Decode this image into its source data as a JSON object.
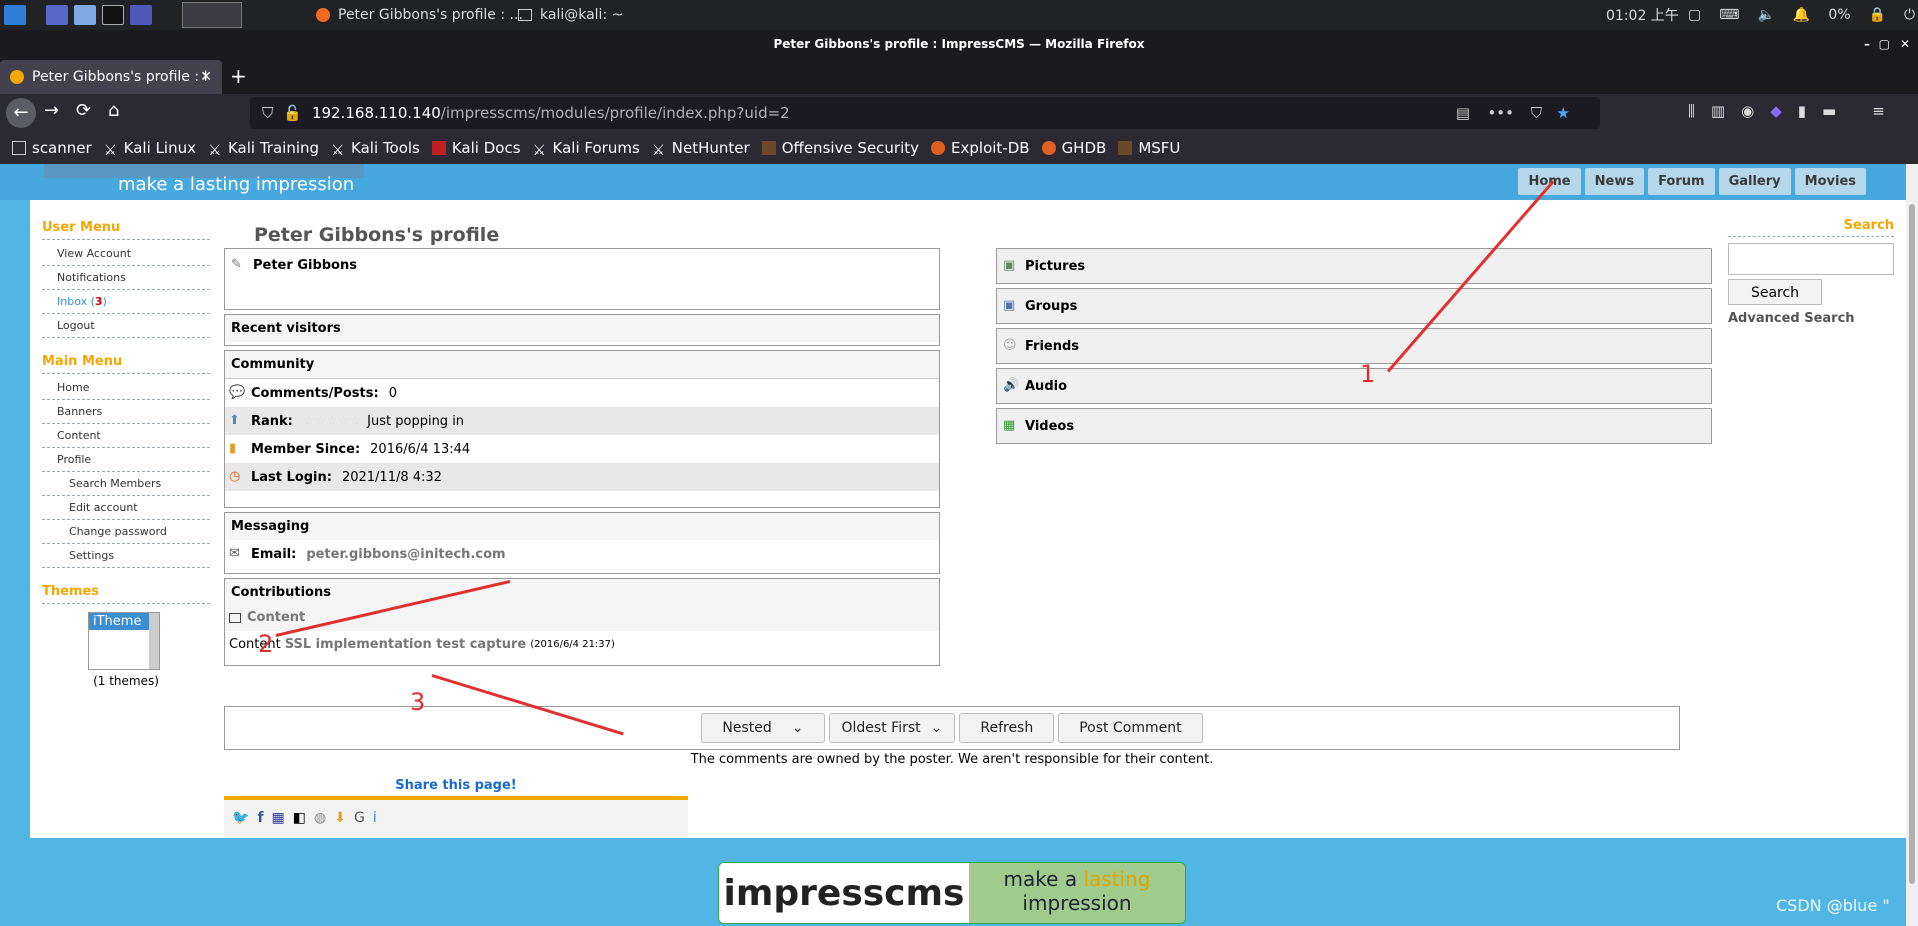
{
  "taskbar": {
    "task_firefox": "Peter Gibbons's profile : ...",
    "task_terminal": "kali@kali: ~",
    "time": "01:02 上午",
    "battery": "0%"
  },
  "window": {
    "title": "Peter Gibbons's profile : ImpressCMS — Mozilla Firefox"
  },
  "tab": {
    "label": "Peter Gibbons's profile : I"
  },
  "url": {
    "host": "192.168.110.140",
    "path": "/impresscms/modules/profile/index.php?uid=2"
  },
  "bookmarks": [
    "scanner",
    "Kali Linux",
    "Kali Training",
    "Kali Tools",
    "Kali Docs",
    "Kali Forums",
    "NetHunter",
    "Offensive Security",
    "Exploit-DB",
    "GHDB",
    "MSFU"
  ],
  "site": {
    "tagline": "make a lasting impression",
    "topnav": [
      "Home",
      "News",
      "Forum",
      "Gallery",
      "Movies"
    ]
  },
  "user_menu": {
    "title": "User Menu",
    "items": [
      "View Account",
      "Notifications",
      "Inbox",
      "Logout"
    ],
    "inbox_count": "3"
  },
  "main_menu": {
    "title": "Main Menu",
    "items": [
      "Home",
      "Banners",
      "Content",
      "Profile"
    ],
    "sub_items": [
      "Search Members",
      "Edit account",
      "Change password",
      "Settings"
    ]
  },
  "themes": {
    "title": "Themes",
    "selected": "iTheme",
    "count": "(1 themes)"
  },
  "profile": {
    "page_title": "Peter Gibbons's profile",
    "name": "Peter Gibbons",
    "recent_visitors": "Recent visitors",
    "community_title": "Community",
    "comments_label": "Comments/Posts:",
    "comments_value": "0",
    "rank_label": "Rank:",
    "rank_value": "Just popping in",
    "member_since_label": "Member Since:",
    "member_since_value": "2016/6/4 13:44",
    "last_login_label": "Last Login:",
    "last_login_value": "2021/11/8 4:32",
    "messaging_title": "Messaging",
    "email_label": "Email:",
    "email_value": "peter.gibbons@initech.com",
    "contributions_title": "Contributions",
    "contrib_section": "Content",
    "contrib_prefix": "Content",
    "contrib_link": "SSL implementation test capture",
    "contrib_date": "(2016/6/4 21:37)"
  },
  "right_panels": [
    "Pictures",
    "Groups",
    "Friends",
    "Audio",
    "Videos"
  ],
  "search": {
    "title": "Search",
    "button": "Search",
    "advanced": "Advanced Search"
  },
  "comments": {
    "mode": "Nested",
    "order": "Oldest First",
    "refresh": "Refresh",
    "post": "Post Comment",
    "disclaimer": "The comments are owned by the poster. We aren't responsible for their content."
  },
  "share": {
    "title": "Share this page!"
  },
  "footer": {
    "logo_left": "impresscms",
    "logo_right_1": "make a",
    "logo_right_accent": "lasting",
    "logo_right_2": "impression"
  },
  "annotations": [
    "1",
    "2",
    "3"
  ],
  "watermark": "CSDN @blue \""
}
